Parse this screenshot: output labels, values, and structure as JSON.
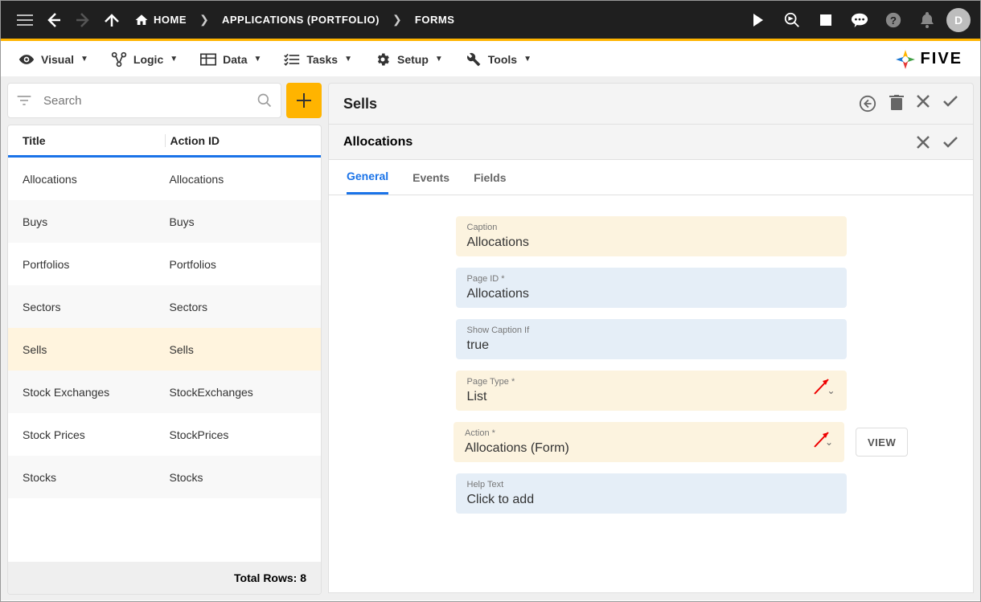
{
  "topbar": {
    "home_label": "HOME",
    "breadcrumb1": "APPLICATIONS (PORTFOLIO)",
    "breadcrumb2": "FORMS",
    "avatar_letter": "D"
  },
  "menubar": {
    "items": [
      {
        "icon": "eye",
        "label": "Visual"
      },
      {
        "icon": "logic",
        "label": "Logic"
      },
      {
        "icon": "table",
        "label": "Data"
      },
      {
        "icon": "tasks",
        "label": "Tasks"
      },
      {
        "icon": "gear",
        "label": "Setup"
      },
      {
        "icon": "tools",
        "label": "Tools"
      }
    ],
    "logo_text": "FIVE"
  },
  "search": {
    "placeholder": "Search"
  },
  "list": {
    "header": {
      "col1": "Title",
      "col2": "Action ID"
    },
    "rows": [
      {
        "title": "Allocations",
        "action_id": "Allocations",
        "selected": false
      },
      {
        "title": "Buys",
        "action_id": "Buys",
        "selected": false
      },
      {
        "title": "Portfolios",
        "action_id": "Portfolios",
        "selected": false
      },
      {
        "title": "Sectors",
        "action_id": "Sectors",
        "selected": false
      },
      {
        "title": "Sells",
        "action_id": "Sells",
        "selected": true
      },
      {
        "title": "Stock Exchanges",
        "action_id": "StockExchanges",
        "selected": false
      },
      {
        "title": "Stock Prices",
        "action_id": "StockPrices",
        "selected": false
      },
      {
        "title": "Stocks",
        "action_id": "Stocks",
        "selected": false
      }
    ],
    "footer": "Total Rows: 8"
  },
  "main_panel": {
    "title": "Sells",
    "sub_title": "Allocations",
    "tabs": [
      {
        "label": "General",
        "active": true
      },
      {
        "label": "Events",
        "active": false
      },
      {
        "label": "Fields",
        "active": false
      }
    ],
    "fields": {
      "caption": {
        "label": "Caption",
        "value": "Allocations"
      },
      "page_id": {
        "label": "Page ID *",
        "value": "Allocations"
      },
      "show_caption_if": {
        "label": "Show Caption If",
        "value": "true"
      },
      "page_type": {
        "label": "Page Type *",
        "value": "List"
      },
      "action": {
        "label": "Action *",
        "value": "Allocations (Form)"
      },
      "help_text": {
        "label": "Help Text",
        "value": "Click to add"
      }
    },
    "view_button": "VIEW"
  }
}
